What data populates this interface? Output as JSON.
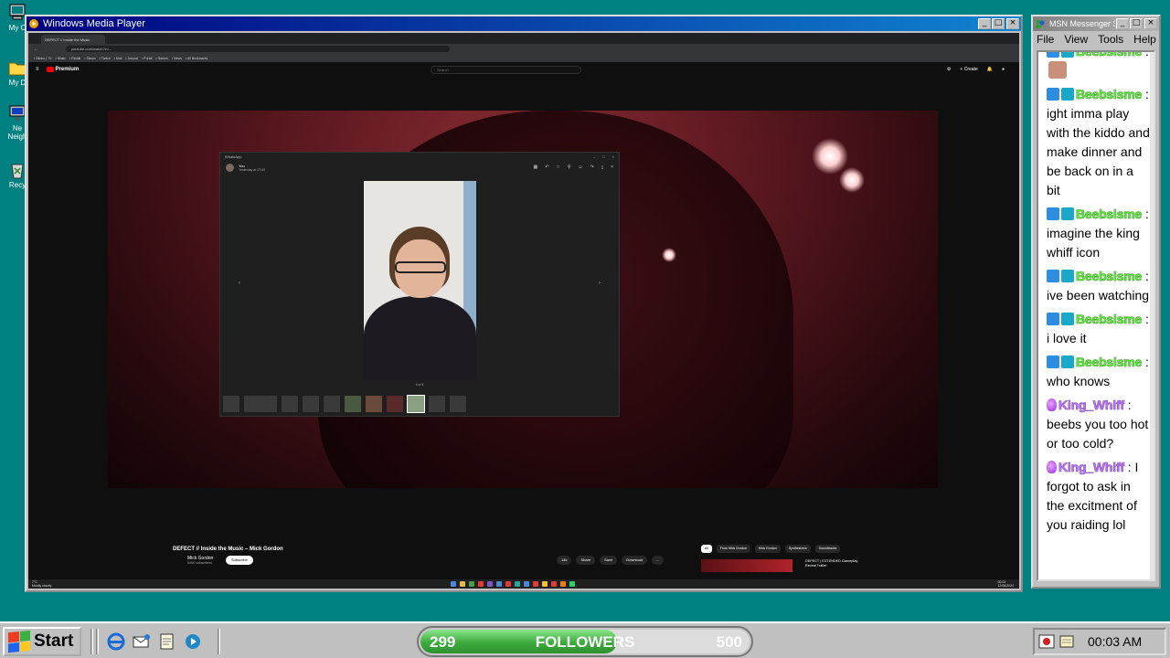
{
  "desktop": {
    "icons": [
      {
        "label": "My C",
        "icon": "my-computer-icon"
      },
      {
        "label": "My D",
        "icon": "my-documents-icon"
      },
      {
        "label": "Ne Neigh",
        "icon": "network-neighborhood-icon"
      },
      {
        "label": "Recy",
        "icon": "recycle-bin-icon"
      }
    ]
  },
  "wmp": {
    "title": "Windows Media Player",
    "browser": {
      "tab_title": "DEFECT // Inside the Music",
      "address": "youtube.com/watch?v=...",
      "youtube_logo": "Premium",
      "search_placeholder": "Search",
      "create_label": "+ Create"
    },
    "whatsapp": {
      "app_title": "WhatsApp",
      "sender": "You",
      "timestamp": "Yesterday at 17:00",
      "counter": "4 of 4"
    },
    "video_info": {
      "title": "DEFECT // Inside the Music – Mick Gordon",
      "channel": "Mick Gordon",
      "subscribers": "545K subscribers",
      "subscribe": "Subscribe",
      "actions": [
        "14k",
        "Share",
        "Save",
        "Download",
        "..."
      ],
      "chips": [
        "All",
        "From Mick Gordon",
        "Mick Gordon",
        "Synthesizers",
        "Soundtracks"
      ],
      "reco_title": "DEFECT | EXTENDED Gameplay Reveal Trailer"
    },
    "win_taskbar": {
      "weather_temp": "7°C",
      "weather_desc": "Mostly cloudy",
      "time": "00:03",
      "date": "12/06/2024"
    }
  },
  "msn": {
    "title": "MSN Messenger Service",
    "menu": [
      "File",
      "View",
      "Tools",
      "Help"
    ],
    "messages": [
      {
        "user": "Beebsisme",
        "text": "",
        "style": "green",
        "emote": true
      },
      {
        "user": "Beebsisme",
        "text": "ight imma play with the kiddo and make dinner and be back on in a bit",
        "style": "green"
      },
      {
        "user": "Beebsisme",
        "text": "imagine the king whiff icon",
        "style": "green"
      },
      {
        "user": "Beebsisme",
        "text": "ive been watching",
        "style": "green"
      },
      {
        "user": "Beebsisme",
        "text": "i love it",
        "style": "green"
      },
      {
        "user": "Beebsisme",
        "text": "who knows",
        "style": "green"
      },
      {
        "user": "King_Whiff",
        "text": "beebs you too hot or too cold?",
        "style": "purple"
      },
      {
        "user": "King_Whiff",
        "text": "I forgot to ask in the excitment of you raiding lol",
        "style": "purple"
      }
    ]
  },
  "taskbar": {
    "start_label": "Start",
    "quick_launch": [
      "internet-explorer-icon",
      "outlook-express-icon",
      "notepad-icon",
      "media-icon"
    ],
    "followers": {
      "label": "FOLLOWERS",
      "current": "299",
      "goal": "500",
      "progress": 0.598
    },
    "clock": "00:03 AM"
  },
  "colors": {
    "desktop": "#008080",
    "title_active": "#000080",
    "msn_green": "#5ce23a",
    "msn_purple": "#b570f0",
    "followers_green": "#3cab3c"
  }
}
